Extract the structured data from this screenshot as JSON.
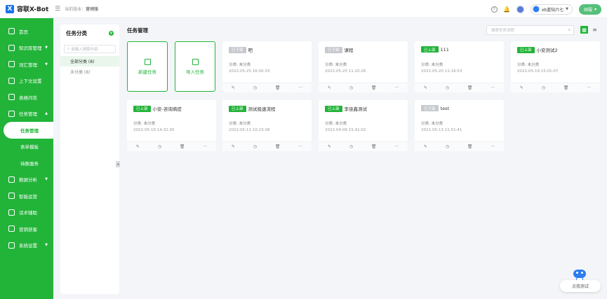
{
  "header": {
    "brand": "容联X-Bot",
    "crumb_label": "当前版本：",
    "crumb_value": "营销版",
    "bot_name": "xb蓝钻六七",
    "action_label": "国服"
  },
  "sidebar": {
    "items": [
      {
        "label": "首页",
        "icon": "home-icon"
      },
      {
        "label": "知识库管理",
        "icon": "book-icon",
        "expandable": true
      },
      {
        "label": "词汇管理",
        "icon": "vocab-icon",
        "expandable": true
      },
      {
        "label": "上下文设置",
        "icon": "context-icon"
      },
      {
        "label": "表格问答",
        "icon": "table-icon"
      },
      {
        "label": "任务管理",
        "icon": "task-icon",
        "expandable": true,
        "expanded": true
      }
    ],
    "sub_items": [
      {
        "label": "任务管理",
        "active": true
      },
      {
        "label": "表单模板"
      },
      {
        "label": "待数服务"
      }
    ],
    "items_after": [
      {
        "label": "数据分析",
        "icon": "chart-icon",
        "expandable": true
      },
      {
        "label": "智能运营",
        "icon": "shield-icon"
      },
      {
        "label": "话术辅助",
        "icon": "phone-icon"
      },
      {
        "label": "营销获客",
        "icon": "marketing-icon"
      },
      {
        "label": "系统设置",
        "icon": "settings-icon",
        "expandable": true
      }
    ]
  },
  "category_panel": {
    "title": "任务分类",
    "search_placeholder": "请输入搜索内容",
    "items": [
      {
        "label": "全部分类 (8)",
        "active": true
      },
      {
        "label": "未分类 (8)"
      }
    ]
  },
  "main": {
    "title": "任务管理",
    "search_placeholder": "搜索任务流程",
    "actions": [
      {
        "label": "新建任务",
        "icon": "new-task-icon"
      },
      {
        "label": "导入任务",
        "icon": "import-task-icon"
      }
    ],
    "status_on": "已上架",
    "status_off": "已下架",
    "tasks": [
      {
        "status": "off",
        "name": "吧",
        "category": "分类: 未分类",
        "date": "2022-05-25 16:00:33"
      },
      {
        "status": "off",
        "name": "课程",
        "category": "分类: 未分类",
        "date": "2022-05-20 11:20:26"
      },
      {
        "status": "on",
        "name": "111",
        "category": "分类: 未分类",
        "date": "2022-05-20 11:16:53"
      },
      {
        "status": "on",
        "name": "小安测试2",
        "category": "分类: 未分类",
        "date": "2022-05-19 15:01:07"
      },
      {
        "status": "on",
        "name": "小安-咨询病症",
        "category": "分类: 未分类",
        "date": "2022-05-19 14:32:30"
      },
      {
        "status": "on",
        "name": "测试极速流程",
        "category": "分类: 未分类",
        "date": "2022-05-11 10:23:38"
      },
      {
        "status": "on",
        "name": "李佳鑫测试",
        "category": "分类: 未分类",
        "date": "2022-04-06 15:41:02"
      },
      {
        "status": "off",
        "name": "test",
        "category": "分类: 未分类",
        "date": "2021-05-13 11:51:41"
      }
    ],
    "card_tools": [
      "edit-icon",
      "history-icon",
      "delete-icon",
      "more-icon"
    ]
  },
  "assistant": {
    "button_label": "点我测试"
  },
  "colors": {
    "accent": "#22b439",
    "status_on": "#22b439",
    "status_off": "#c6c9ce",
    "brand_blue": "#1a73e8"
  }
}
